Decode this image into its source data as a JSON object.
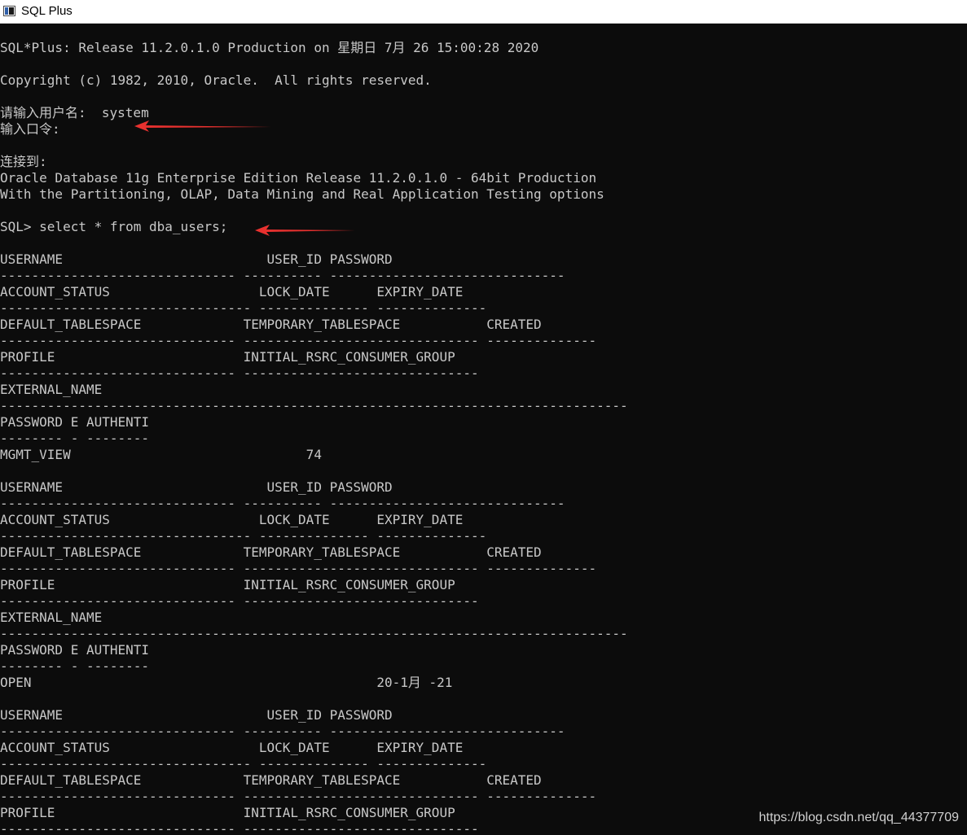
{
  "window": {
    "title": "SQL Plus",
    "icon": "sqlplus-console-icon"
  },
  "console": {
    "lines": [
      "",
      "SQL*Plus: Release 11.2.0.1.0 Production on 星期日 7月 26 15:00:28 2020",
      "",
      "Copyright (c) 1982, 2010, Oracle.  All rights reserved.",
      "",
      "请输入用户名:  system",
      "输入口令:",
      "",
      "连接到:",
      "Oracle Database 11g Enterprise Edition Release 11.2.0.1.0 - 64bit Production",
      "With the Partitioning, OLAP, Data Mining and Real Application Testing options",
      "",
      "SQL> select * from dba_users;",
      "",
      "USERNAME                          USER_ID PASSWORD",
      "------------------------------ ---------- ------------------------------",
      "ACCOUNT_STATUS                   LOCK_DATE      EXPIRY_DATE",
      "-------------------------------- -------------- --------------",
      "DEFAULT_TABLESPACE             TEMPORARY_TABLESPACE           CREATED",
      "------------------------------ ------------------------------ --------------",
      "PROFILE                        INITIAL_RSRC_CONSUMER_GROUP",
      "------------------------------ ------------------------------",
      "EXTERNAL_NAME",
      "--------------------------------------------------------------------------------",
      "PASSWORD E AUTHENTI",
      "-------- - --------",
      "MGMT_VIEW                              74",
      "",
      "USERNAME                          USER_ID PASSWORD",
      "------------------------------ ---------- ------------------------------",
      "ACCOUNT_STATUS                   LOCK_DATE      EXPIRY_DATE",
      "-------------------------------- -------------- --------------",
      "DEFAULT_TABLESPACE             TEMPORARY_TABLESPACE           CREATED",
      "------------------------------ ------------------------------ --------------",
      "PROFILE                        INITIAL_RSRC_CONSUMER_GROUP",
      "------------------------------ ------------------------------",
      "EXTERNAL_NAME",
      "--------------------------------------------------------------------------------",
      "PASSWORD E AUTHENTI",
      "-------- - --------",
      "OPEN                                            20-1月 -21",
      "",
      "USERNAME                          USER_ID PASSWORD",
      "------------------------------ ---------- ------------------------------",
      "ACCOUNT_STATUS                   LOCK_DATE      EXPIRY_DATE",
      "-------------------------------- -------------- --------------",
      "DEFAULT_TABLESPACE             TEMPORARY_TABLESPACE           CREATED",
      "------------------------------ ------------------------------ --------------",
      "PROFILE                        INITIAL_RSRC_CONSUMER_GROUP",
      "------------------------------ ------------------------------"
    ]
  },
  "annotations": {
    "arrow_color": "#e8312f",
    "arrows": [
      "annotation-arrow-username",
      "annotation-arrow-query"
    ]
  },
  "watermark": {
    "text": "https://blog.csdn.net/qq_44377709"
  },
  "colors": {
    "console_background": "#0c0c0c",
    "console_text": "#c8c8c8",
    "titlebar_background": "#ffffff"
  }
}
